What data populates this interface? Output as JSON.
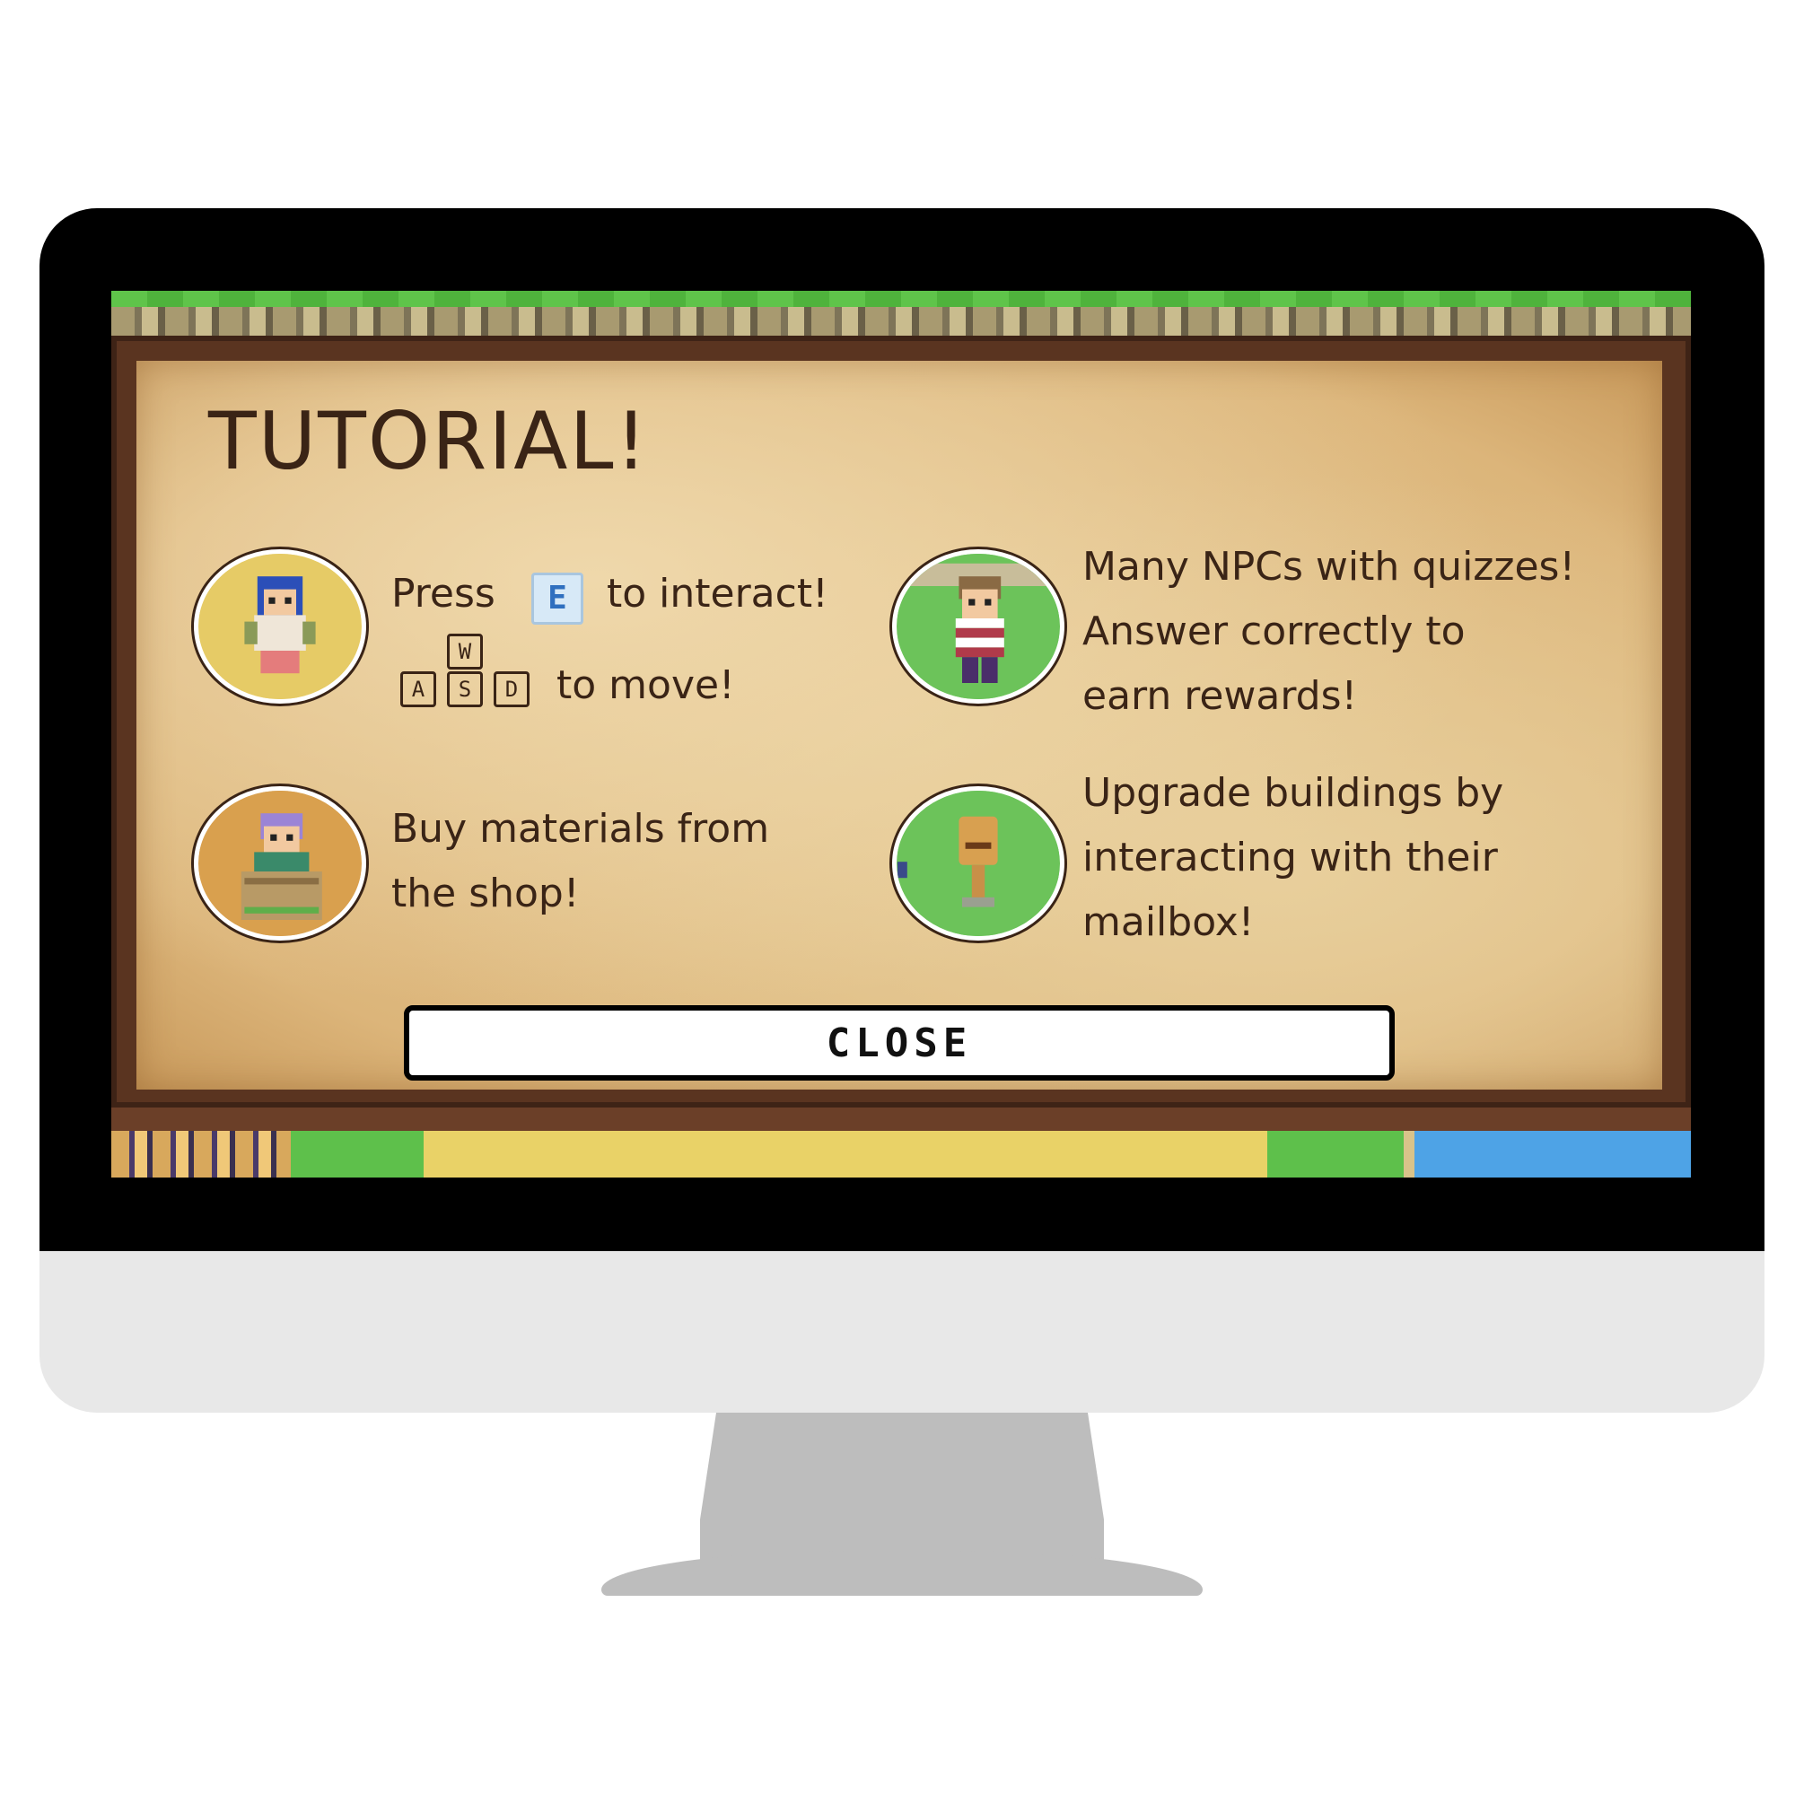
{
  "tutorial": {
    "title": "TUTORIAL!",
    "tips": [
      {
        "portrait_icon": "blue-hair-villager-icon",
        "line1_pre": "Press",
        "key_interact": "E",
        "line1_post": "to interact!",
        "keys_move": [
          "W",
          "A",
          "S",
          "D"
        ],
        "line2": "to move!"
      },
      {
        "portrait_icon": "npc-quiz-character-icon",
        "lines": [
          "Many NPCs with quizzes!",
          "Answer correctly to",
          "earn rewards!"
        ]
      },
      {
        "portrait_icon": "shopkeeper-icon",
        "lines": [
          "Buy materials from",
          "the shop!"
        ]
      },
      {
        "portrait_icon": "mailbox-icon",
        "lines": [
          "Upgrade buildings by",
          "interacting with their",
          "mailbox!"
        ]
      }
    ],
    "close_label": "CLOSE"
  },
  "colors": {
    "parchment": "#e6c993",
    "wood": "#5a3420",
    "text": "#3a2416",
    "grass": "#5ec04b",
    "water": "#4ea3e6",
    "monitor_bezel": "#000000",
    "monitor_chin": "#e8e8e8"
  }
}
